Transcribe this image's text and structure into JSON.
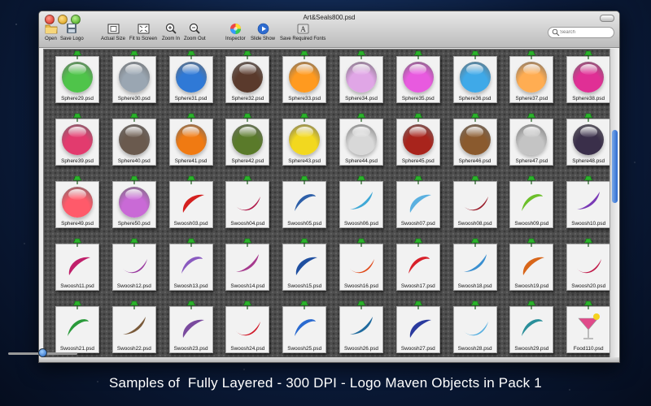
{
  "window": {
    "title": "Art&Seals800.psd"
  },
  "toolbar": {
    "buttons": [
      {
        "label": "Open",
        "icon": "folder-icon"
      },
      {
        "label": "Save Logo",
        "icon": "save-icon"
      },
      {
        "label": "Actual Size",
        "icon": "actual-size-icon"
      },
      {
        "label": "Fit to Screen",
        "icon": "fit-screen-icon"
      },
      {
        "label": "Zoom In",
        "icon": "zoom-in-icon"
      },
      {
        "label": "Zoom Out",
        "icon": "zoom-out-icon"
      },
      {
        "label": "Inspector",
        "icon": "color-wheel-icon"
      },
      {
        "label": "Slide Show",
        "icon": "play-icon"
      },
      {
        "label": "Save Required Fonts",
        "icon": "fonts-icon"
      }
    ],
    "search_placeholder": "Search"
  },
  "thumbnails": [
    {
      "name": "Sphere29.psd",
      "kind": "sphere",
      "color": "#4fc44a"
    },
    {
      "name": "Sphere30.psd",
      "kind": "sphere",
      "color": "#9aa6b2"
    },
    {
      "name": "Sphere31.psd",
      "kind": "sphere",
      "color": "#2f79d6"
    },
    {
      "name": "Sphere32.psd",
      "kind": "sphere",
      "color": "#5a3a2c"
    },
    {
      "name": "Sphere33.psd",
      "kind": "sphere",
      "color": "#ff9a1f"
    },
    {
      "name": "Sphere34.psd",
      "kind": "sphere",
      "color": "#e0a6e6"
    },
    {
      "name": "Sphere35.psd",
      "kind": "sphere",
      "color": "#e85adf"
    },
    {
      "name": "Sphere36.psd",
      "kind": "sphere",
      "color": "#3fa9e8"
    },
    {
      "name": "Sphere37.psd",
      "kind": "sphere",
      "color": "#ffad52"
    },
    {
      "name": "Sphere38.psd",
      "kind": "sphere",
      "color": "#e02f95"
    },
    {
      "name": "Sphere39.psd",
      "kind": "sphere",
      "color": "#e23b6e"
    },
    {
      "name": "Sphere40.psd",
      "kind": "sphere",
      "color": "#6a5a4e"
    },
    {
      "name": "Sphere41.psd",
      "kind": "sphere",
      "color": "#f07a12"
    },
    {
      "name": "Sphere42.psd",
      "kind": "sphere",
      "color": "#5a7a2a"
    },
    {
      "name": "Sphere43.psd",
      "kind": "sphere",
      "color": "#f2d81f"
    },
    {
      "name": "Sphere44.psd",
      "kind": "sphere",
      "color": "#d8d8d8"
    },
    {
      "name": "Sphere45.psd",
      "kind": "sphere",
      "color": "#a8241c"
    },
    {
      "name": "Sphere46.psd",
      "kind": "sphere",
      "color": "#8a5a2e"
    },
    {
      "name": "Sphere47.psd",
      "kind": "sphere",
      "color": "#c4c4c4"
    },
    {
      "name": "Sphere48.psd",
      "kind": "sphere",
      "color": "#3a2f4a"
    },
    {
      "name": "Sphere49.psd",
      "kind": "sphere",
      "color": "#ff5a6a"
    },
    {
      "name": "Sphere50.psd",
      "kind": "sphere",
      "color": "#c96ad6"
    },
    {
      "name": "Swoosh03.psd",
      "kind": "swoosh",
      "color": "#d4201f"
    },
    {
      "name": "Swoosh04.psd",
      "kind": "swoosh",
      "color": "#b01a4a"
    },
    {
      "name": "Swoosh05.psd",
      "kind": "swoosh",
      "color": "#2d5fa8"
    },
    {
      "name": "Swoosh06.psd",
      "kind": "swoosh",
      "color": "#3fa8d6"
    },
    {
      "name": "Swoosh07.psd",
      "kind": "swoosh",
      "color": "#5ab0e0"
    },
    {
      "name": "Swoosh08.psd",
      "kind": "swoosh",
      "color": "#9a1c2a"
    },
    {
      "name": "Swoosh09.psd",
      "kind": "swoosh",
      "color": "#6cbf2a"
    },
    {
      "name": "Swoosh10.psd",
      "kind": "swoosh",
      "color": "#7a3ab6"
    },
    {
      "name": "Swoosh11.psd",
      "kind": "swoosh",
      "color": "#c01f6a"
    },
    {
      "name": "Swoosh12.psd",
      "kind": "swoosh",
      "color": "#9a3aa0"
    },
    {
      "name": "Swoosh13.psd",
      "kind": "swoosh",
      "color": "#8a5ac0"
    },
    {
      "name": "Swoosh14.psd",
      "kind": "swoosh",
      "color": "#a63a8e"
    },
    {
      "name": "Swoosh15.psd",
      "kind": "swoosh",
      "color": "#1f4fa0"
    },
    {
      "name": "Swoosh16.psd",
      "kind": "swoosh",
      "color": "#e04a1a"
    },
    {
      "name": "Swoosh17.psd",
      "kind": "swoosh",
      "color": "#d8202a"
    },
    {
      "name": "Swoosh18.psd",
      "kind": "swoosh",
      "color": "#3a8fd0"
    },
    {
      "name": "Swoosh19.psd",
      "kind": "swoosh",
      "color": "#d8661a"
    },
    {
      "name": "Swoosh20.psd",
      "kind": "swoosh",
      "color": "#c01a4a"
    },
    {
      "name": "Swoosh21.psd",
      "kind": "swoosh",
      "color": "#2a9a3a"
    },
    {
      "name": "Swoosh22.psd",
      "kind": "swoosh",
      "color": "#7a5a3a"
    },
    {
      "name": "Swoosh23.psd",
      "kind": "swoosh",
      "color": "#7a4a9e"
    },
    {
      "name": "Swoosh24.psd",
      "kind": "swoosh",
      "color": "#d01a2a"
    },
    {
      "name": "Swoosh25.psd",
      "kind": "swoosh",
      "color": "#2a6ad0"
    },
    {
      "name": "Swoosh26.psd",
      "kind": "swoosh",
      "color": "#1f6a9e"
    },
    {
      "name": "Swoosh27.psd",
      "kind": "swoosh",
      "color": "#2a3a9e"
    },
    {
      "name": "Swoosh28.psd",
      "kind": "swoosh",
      "color": "#5ab0e0"
    },
    {
      "name": "Swoosh29.psd",
      "kind": "swoosh",
      "color": "#2a8f9a"
    },
    {
      "name": "Food110.psd",
      "kind": "cocktail",
      "color": "#e04a8a"
    }
  ]
}
